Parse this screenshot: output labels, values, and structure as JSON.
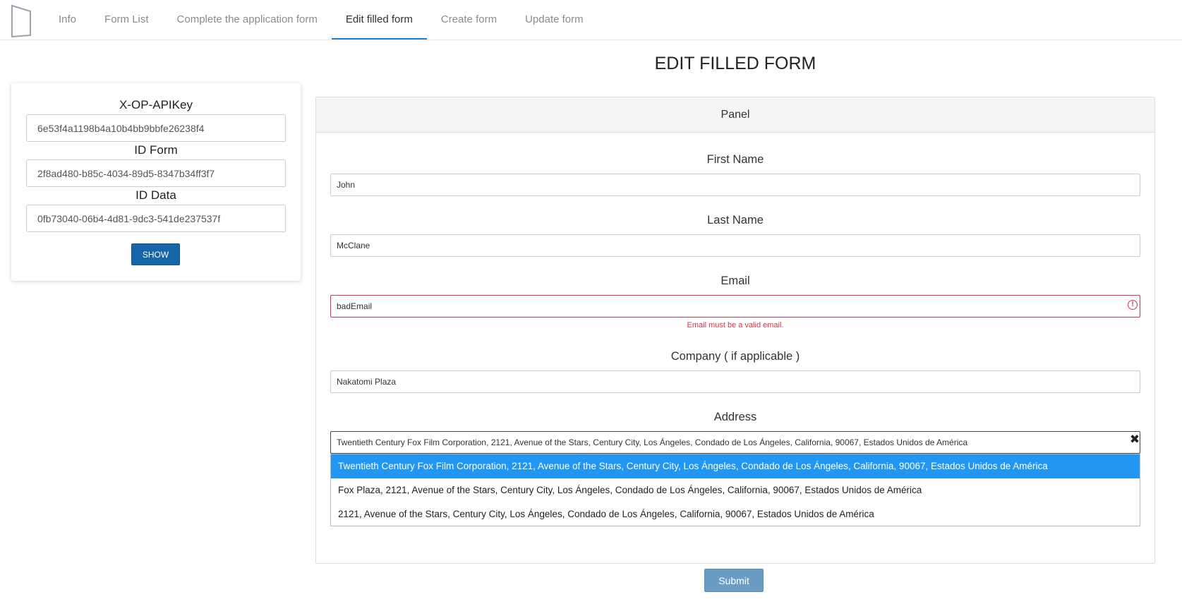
{
  "nav": {
    "tabs": [
      {
        "label": "Info"
      },
      {
        "label": "Form List"
      },
      {
        "label": "Complete the application form"
      },
      {
        "label": "Edit filled form",
        "active": true
      },
      {
        "label": "Create form"
      },
      {
        "label": "Update form"
      }
    ]
  },
  "page": {
    "title": "EDIT FILLED FORM"
  },
  "sidebar": {
    "api_key_label": "X-OP-APIKey",
    "api_key_value": "6e53f4a1198b4a10b4bb9bbfe26238f4",
    "form_id_label": "ID Form",
    "form_id_value": "2f8ad480-b85c-4034-89d5-8347b34ff3f7",
    "data_id_label": "ID Data",
    "data_id_value": "0fb73040-06b4-4d81-9dc3-541de237537f",
    "show_label": "SHOW"
  },
  "panel": {
    "heading": "Panel",
    "first_name": {
      "label": "First Name",
      "value": "John"
    },
    "last_name": {
      "label": "Last Name",
      "value": "McClane"
    },
    "email": {
      "label": "Email",
      "value": "badEmail",
      "error": "Email must be a valid email."
    },
    "company": {
      "label": "Company ( if applicable )",
      "value": "Nakatomi Plaza"
    },
    "address": {
      "label": "Address",
      "value": "Twentieth Century Fox Film Corporation, 2121, Avenue of the Stars, Century City, Los Ángeles, Condado de Los Ángeles, California, 90067, Estados Unidos de América",
      "options": [
        "Twentieth Century Fox Film Corporation, 2121, Avenue of the Stars, Century City, Los Ángeles, Condado de Los Ángeles, California, 90067, Estados Unidos de América",
        "Fox Plaza, 2121, Avenue of the Stars, Century City, Los Ángeles, Condado de Los Ángeles, California, 90067, Estados Unidos de América",
        "2121, Avenue of the Stars, Century City, Los Ángeles, Condado de Los Ángeles, California, 90067, Estados Unidos de América"
      ]
    }
  },
  "submit_label": "Submit",
  "colors": {
    "accent": "#1f7fd6",
    "show_button": "#1565a8",
    "submit_button": "#6a9cc4",
    "error": "#d9344a",
    "highlight": "#2196f3"
  },
  "icons": {
    "logo": "logo-icon",
    "error": "error-circle-icon",
    "clear": "close-icon"
  }
}
